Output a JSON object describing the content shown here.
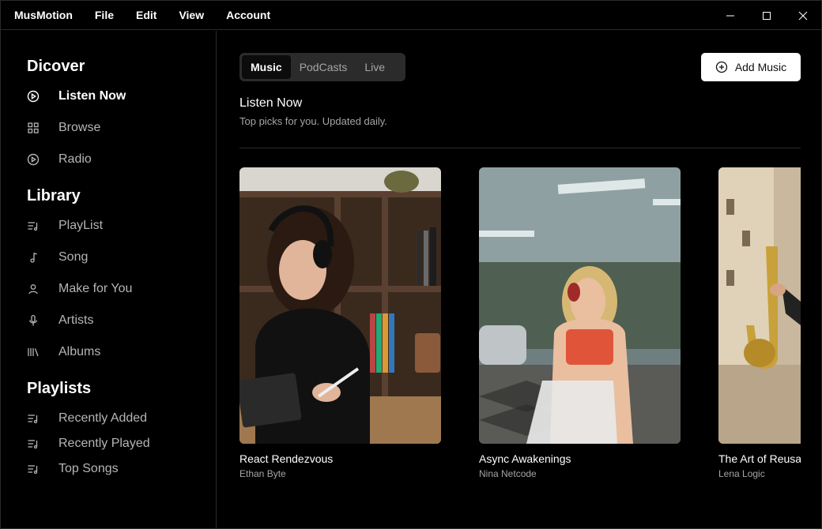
{
  "app": {
    "name": "MusMotion"
  },
  "menu": [
    "File",
    "Edit",
    "View",
    "Account"
  ],
  "window_controls": {
    "minimize": "minimize-icon",
    "maximize": "maximize-icon",
    "close": "close-icon"
  },
  "sidebar": {
    "discover": {
      "title": "Dicover",
      "items": [
        {
          "label": "Listen Now",
          "icon": "play-circle-icon",
          "active": true
        },
        {
          "label": "Browse",
          "icon": "grid-icon"
        },
        {
          "label": "Radio",
          "icon": "radio-icon"
        }
      ]
    },
    "library": {
      "title": "Library",
      "items": [
        {
          "label": "PlayList",
          "icon": "playlist-icon"
        },
        {
          "label": "Song",
          "icon": "music-note-icon"
        },
        {
          "label": "Make for You",
          "icon": "user-icon"
        },
        {
          "label": "Artists",
          "icon": "microphone-icon"
        },
        {
          "label": "Albums",
          "icon": "library-icon"
        }
      ]
    },
    "playlists": {
      "title": "Playlists",
      "items": [
        {
          "label": "Recently Added",
          "icon": "playlist-icon"
        },
        {
          "label": "Recently Played",
          "icon": "playlist-icon"
        },
        {
          "label": "Top Songs",
          "icon": "playlist-icon"
        }
      ]
    }
  },
  "main": {
    "tabs": [
      {
        "label": "Music",
        "active": true
      },
      {
        "label": "PodCasts"
      },
      {
        "label": "Live"
      }
    ],
    "add_button": {
      "label": "Add Music",
      "icon": "plus-circle-icon"
    },
    "heading": "Listen Now",
    "subheading": "Top picks for you. Updated daily.",
    "albums": [
      {
        "title": "React Rendezvous",
        "artist": "Ethan Byte"
      },
      {
        "title": "Async Awakenings",
        "artist": "Nina Netcode"
      },
      {
        "title": "The Art of Reusability",
        "artist": "Lena Logic"
      }
    ]
  },
  "colors": {
    "background": "#000000",
    "muted_text": "#a5a5a5",
    "border": "#2a2a2a",
    "tab_bg": "#2b2b2b"
  }
}
